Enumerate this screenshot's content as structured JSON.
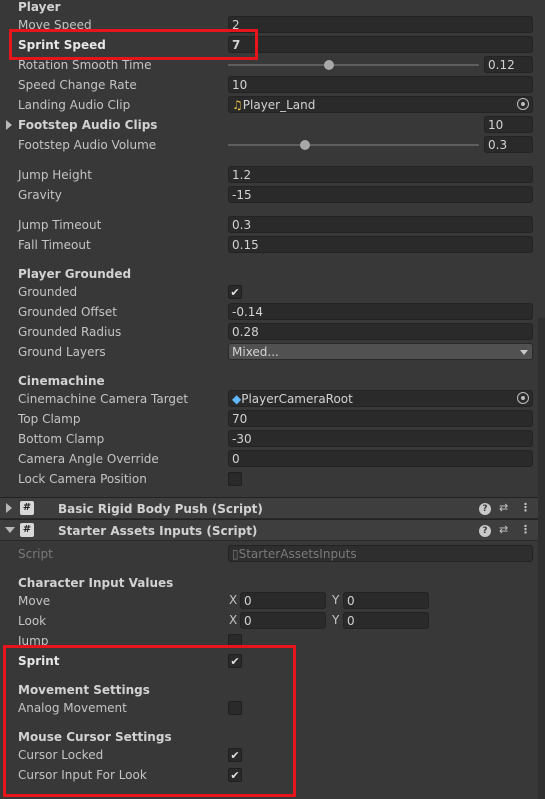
{
  "player": {
    "header": "Player",
    "move_speed": {
      "label": "Move Speed",
      "value": "2"
    },
    "sprint_speed": {
      "label": "Sprint Speed",
      "value": "7"
    },
    "rotation_smooth_time": {
      "label": "Rotation Smooth Time",
      "value": "0.12",
      "slider_fraction": 0.4
    },
    "speed_change_rate": {
      "label": "Speed Change Rate",
      "value": "10"
    },
    "landing_audio_clip": {
      "label": "Landing Audio Clip",
      "value": "Player_Land",
      "icon": "audio-clip-icon"
    },
    "footstep_audio_clips": {
      "label": "Footstep Audio Clips",
      "value": "10"
    },
    "footstep_audio_volume": {
      "label": "Footstep Audio Volume",
      "value": "0.3",
      "slider_fraction": 0.3
    },
    "jump_height": {
      "label": "Jump Height",
      "value": "1.2"
    },
    "gravity": {
      "label": "Gravity",
      "value": "-15"
    },
    "jump_timeout": {
      "label": "Jump Timeout",
      "value": "0.3"
    },
    "fall_timeout": {
      "label": "Fall Timeout",
      "value": "0.15"
    }
  },
  "grounded": {
    "header": "Player Grounded",
    "grounded": {
      "label": "Grounded",
      "checked": true
    },
    "grounded_offset": {
      "label": "Grounded Offset",
      "value": "-0.14"
    },
    "grounded_radius": {
      "label": "Grounded Radius",
      "value": "0.28"
    },
    "ground_layers": {
      "label": "Ground Layers",
      "value": "Mixed..."
    }
  },
  "cinemachine": {
    "header": "Cinemachine",
    "camera_target": {
      "label": "Cinemachine Camera Target",
      "value": "PlayerCameraRoot"
    },
    "top_clamp": {
      "label": "Top Clamp",
      "value": "70"
    },
    "bottom_clamp": {
      "label": "Bottom Clamp",
      "value": "-30"
    },
    "camera_angle_override": {
      "label": "Camera Angle Override",
      "value": "0"
    },
    "lock_camera_position": {
      "label": "Lock Camera Position",
      "checked": false
    }
  },
  "components": {
    "rigid_body_push": {
      "title": "Basic Rigid Body Push (Script)",
      "expanded": false
    },
    "starter_assets_inputs": {
      "title": "Starter Assets Inputs (Script)",
      "expanded": true
    }
  },
  "inputs": {
    "script": {
      "label": "Script",
      "value": "StarterAssetsInputs"
    },
    "char_header": "Character Input Values",
    "move": {
      "label": "Move",
      "x_label": "X",
      "x": "0",
      "y_label": "Y",
      "y": "0"
    },
    "look": {
      "label": "Look",
      "x_label": "X",
      "x": "0",
      "y_label": "Y",
      "y": "0"
    },
    "jump": {
      "label": "Jump",
      "checked": false
    },
    "sprint": {
      "label": "Sprint",
      "checked": true
    },
    "movement_header": "Movement Settings",
    "analog_movement": {
      "label": "Analog Movement",
      "checked": false
    },
    "cursor_header": "Mouse Cursor Settings",
    "cursor_locked": {
      "label": "Cursor Locked",
      "checked": true
    },
    "cursor_input_for_look": {
      "label": "Cursor Input For Look",
      "checked": true
    }
  },
  "colors": {
    "highlight": "#e8141c",
    "background": "#383838",
    "field": "#2a2a2a"
  }
}
